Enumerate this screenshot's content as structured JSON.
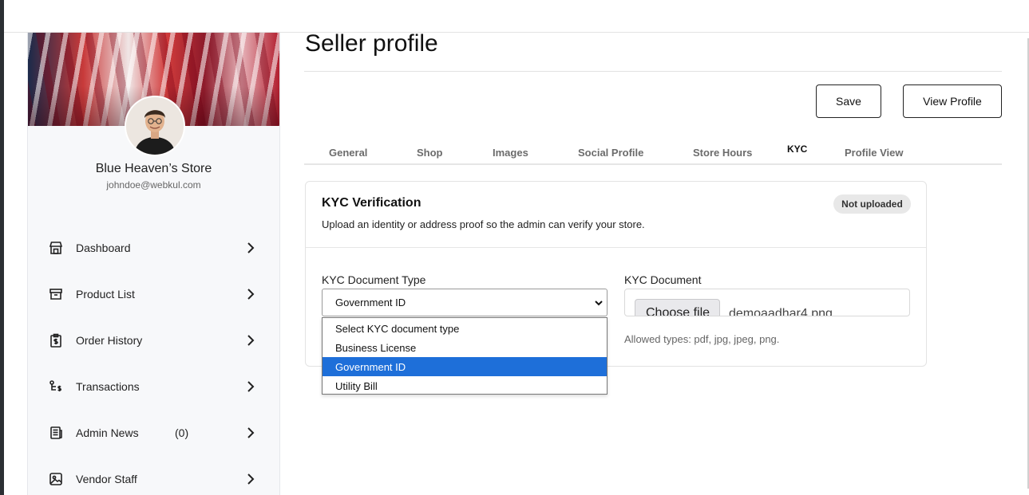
{
  "sidebar": {
    "store_name": "Blue Heaven’s Store",
    "email": "johndoe@webkul.com",
    "items": [
      {
        "label": "Dashboard",
        "icon": "store-icon"
      },
      {
        "label": "Product List",
        "icon": "archive-box-icon"
      },
      {
        "label": "Order History",
        "icon": "clipboard-dollar-icon"
      },
      {
        "label": "Transactions",
        "icon": "transfer-dollar-icon"
      },
      {
        "label": "Admin News",
        "count": "(0)",
        "icon": "newspaper-icon"
      },
      {
        "label": "Vendor Staff",
        "icon": "image-frame-icon"
      }
    ]
  },
  "main": {
    "title": "Seller profile",
    "buttons": {
      "save": "Save",
      "view_profile": "View Profile"
    },
    "tabs": [
      "General",
      "Shop",
      "Images",
      "Social Profile",
      "Store Hours",
      "KYC",
      "Profile View"
    ],
    "active_tab": "KYC",
    "card": {
      "title": "KYC Verification",
      "subtitle": "Upload an identity or address proof so the admin can verify your store.",
      "status_badge": "Not uploaded",
      "doc_type_label": "KYC Document Type",
      "doc_type_value": "Government ID",
      "doc_type_options": [
        "Select KYC document type",
        "Business License",
        "Government ID",
        "Utility Bill"
      ],
      "doc_label": "KYC Document",
      "file_button": "Choose file",
      "file_name": "demoaadhar4.png",
      "allowed_types": "Allowed types: pdf, jpg, jpeg, png."
    }
  },
  "colors": {
    "selected_option": "#1e6fd9",
    "badge_bg": "#e8e8e8"
  }
}
